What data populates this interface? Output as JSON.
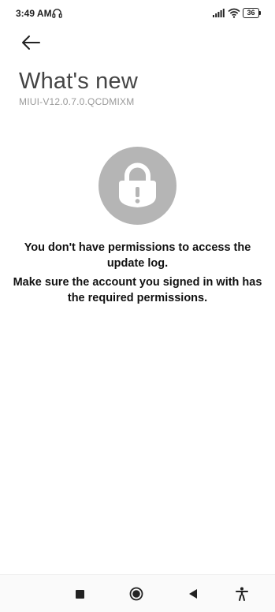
{
  "status_bar": {
    "time": "3:49 AM",
    "battery": "36",
    "icons": [
      "headphone-icon",
      "signal-icon",
      "wifi-icon",
      "battery-icon"
    ]
  },
  "header": {
    "back_icon": "back-arrow-icon",
    "title": "What's new",
    "subtitle": "MIUI-V12.0.7.0.QCDMIXM"
  },
  "lock": {
    "icon": "lock-alert-icon",
    "circle_color": "#b5b5b5"
  },
  "messages": {
    "primary": "You don't have permissions to access the update log.",
    "secondary": "Make sure the account you signed in with has the required permissions."
  },
  "nav_bar": {
    "icons": [
      "recents-icon",
      "home-icon",
      "back-icon",
      "accessibility-icon"
    ]
  }
}
